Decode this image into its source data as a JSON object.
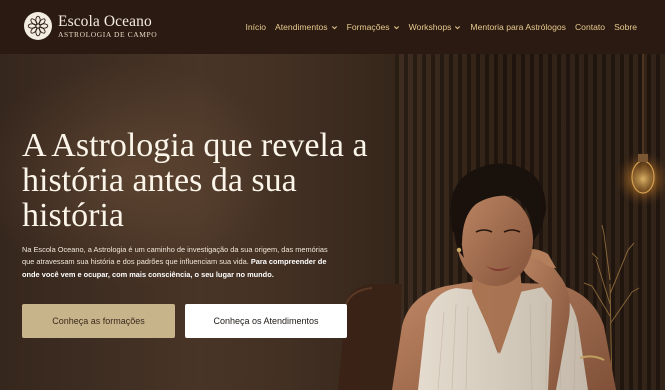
{
  "brand": {
    "name": "Escola Oceano",
    "subtitle": "ASTROLOGIA DE CAMPO",
    "logo_icon": "mandala-flower-icon"
  },
  "nav": {
    "items": [
      {
        "label": "Início",
        "dropdown": false
      },
      {
        "label": "Atendimentos",
        "dropdown": true
      },
      {
        "label": "Formações",
        "dropdown": true
      },
      {
        "label": "Workshops",
        "dropdown": true
      },
      {
        "label": "Mentoria para Astrólogos",
        "dropdown": false
      },
      {
        "label": "Contato",
        "dropdown": false
      },
      {
        "label": "Sobre",
        "dropdown": false
      }
    ],
    "dropdown_icon": "chevron-down-icon"
  },
  "hero": {
    "title": "A Astrologia que revela a história antes da sua história",
    "text_intro": "Na Escola Oceano, a Astrologia é um caminho de investigação da sua origem, das memórias que atravessam sua história e dos padrões que influenciam sua vida. ",
    "text_bold": "Para compreender de onde você vem e ocupar, com mais consciência, o seu lugar no mundo.",
    "primary_button": "Conheça as formações",
    "secondary_button": "Conheça os Atendimentos"
  },
  "colors": {
    "nav_background": "#2b1a11",
    "nav_link": "#e6c98f",
    "primary_button": "#c8b48a",
    "secondary_button": "#ffffff",
    "title_text": "#fbf5ea"
  }
}
